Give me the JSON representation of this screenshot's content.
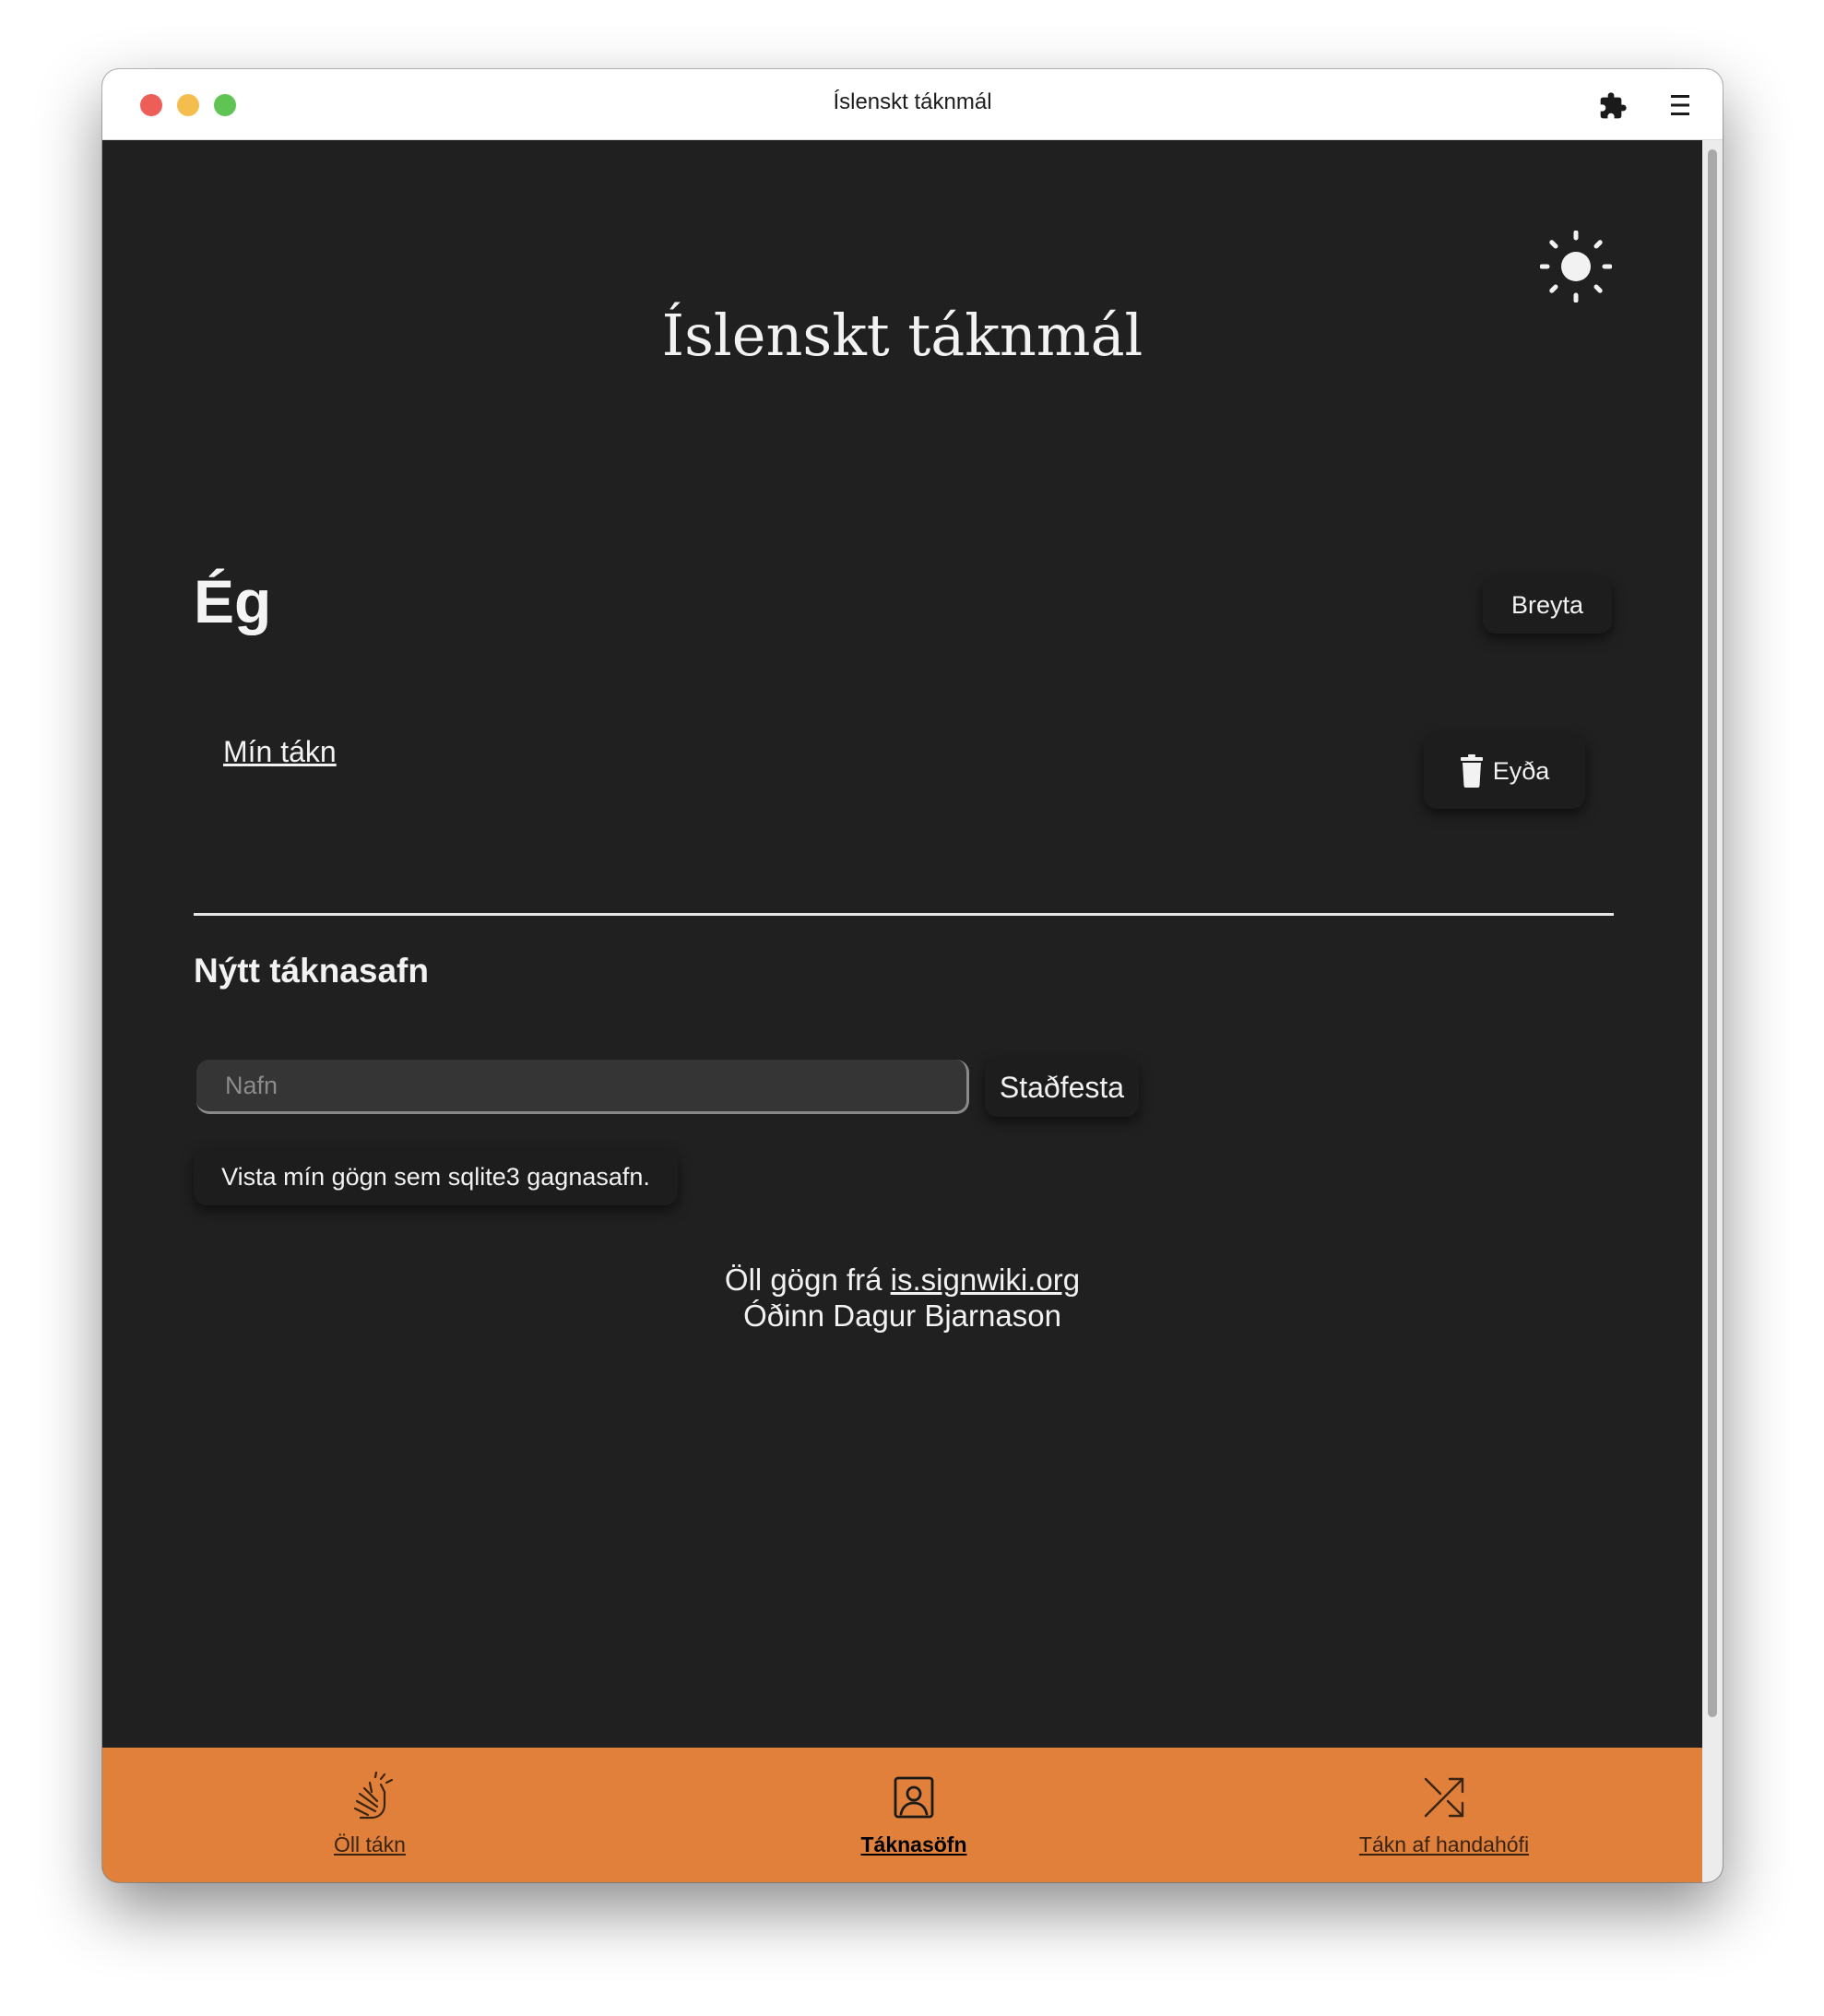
{
  "window": {
    "title": "Íslenskt táknmál"
  },
  "header": {
    "app_title": "Íslenskt táknmál",
    "theme_toggle_icon": "sun-icon"
  },
  "profile": {
    "heading": "Ég",
    "edit_label": "Breyta"
  },
  "collections": [
    {
      "name": "Mín tákn",
      "delete_label": "Eyða"
    }
  ],
  "new_collection": {
    "heading": "Nýtt táknasafn",
    "name_placeholder": "Nafn",
    "name_value": "",
    "confirm_label": "Staðfesta"
  },
  "export": {
    "label": "Vista mín gögn sem sqlite3 gagnasafn."
  },
  "footer": {
    "data_prefix": "Öll gögn frá ",
    "data_link": "is.signwiki.org",
    "author": "Óðinn Dagur Bjarnason"
  },
  "bottom_nav": [
    {
      "label": "Öll tákn",
      "icon": "hand-sign-icon",
      "active": false
    },
    {
      "label": "Táknasöfn",
      "icon": "collection-icon",
      "active": true
    },
    {
      "label": "Tákn af handahófi",
      "icon": "shuffle-icon",
      "active": false
    }
  ],
  "colors": {
    "background": "#202020",
    "accent": "#e0803a",
    "text": "#f2f2f2"
  }
}
